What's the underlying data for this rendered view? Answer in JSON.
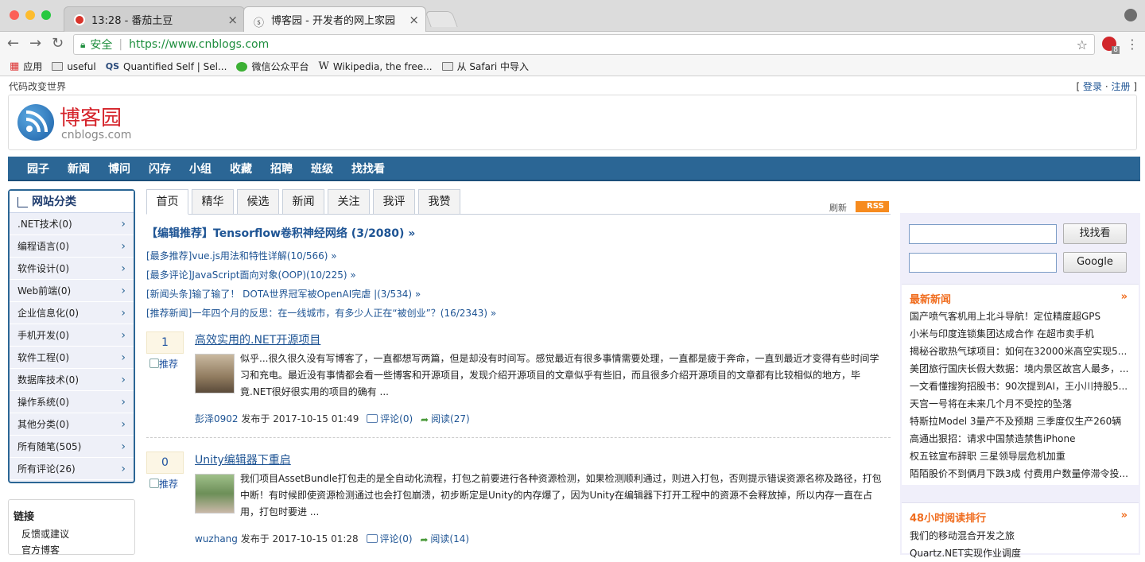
{
  "browser": {
    "tabs": [
      {
        "title": "13:28 - 番茄土豆",
        "active": false
      },
      {
        "title": "博客园 - 开发者的网上家园",
        "active": true
      }
    ],
    "security_label": "安全",
    "url": "https://www.cnblogs.com",
    "extension_badge": "8",
    "bookmarks": [
      "应用",
      "useful",
      "Quantified Self | Sel...",
      "微信公众平台",
      "Wikipedia, the free...",
      "从 Safari 中导入"
    ]
  },
  "site": {
    "slogan": "代码改变世界",
    "login": "登录",
    "register": "注册",
    "logo_cn": "博客园",
    "logo_en": "cnblogs.com",
    "nav": [
      "园子",
      "新闻",
      "博问",
      "闪存",
      "小组",
      "收藏",
      "招聘",
      "班级",
      "找找看"
    ]
  },
  "categories": {
    "title": "网站分类",
    "items": [
      ".NET技术(0)",
      "编程语言(0)",
      "软件设计(0)",
      "Web前端(0)",
      "企业信息化(0)",
      "手机开发(0)",
      "软件工程(0)",
      "数据库技术(0)",
      "操作系统(0)",
      "其他分类(0)",
      "所有随笔(505)",
      "所有评论(26)"
    ]
  },
  "links": {
    "title": "链接",
    "items": [
      "反馈或建议",
      "官方博客"
    ]
  },
  "content_tabs": [
    "首页",
    "精华",
    "候选",
    "新闻",
    "关注",
    "我评",
    "我赞"
  ],
  "refresh_label": "刷新",
  "rss_label": "RSS",
  "headline": "【编辑推荐】Tensorflow卷积神经网络 (3/2080) »",
  "sub_headlines": [
    "[最多推荐]vue.js用法和特性详解(10/566) »",
    "[最多评论]JavaScript面向对象(OOP)(10/225) »",
    "[新闻头条]输了输了！ DOTA世界冠军被OpenAI完虐 |(3/534) »",
    "[推荐新闻]一年四个月的反思：在一线城市，有多少人正在“被创业”？(16/2343) »"
  ],
  "posts": [
    {
      "digg": "1",
      "recommend": "推荐",
      "title": "高效实用的.NET开源项目",
      "summary": "似乎...很久很久没有写博客了，一直都想写两篇，但是却没有时间写。感觉最近有很多事情需要处理，一直都是疲于奔命，一直到最近才变得有些时间学习和充电。最近没有事情都会看一些博客和开源项目，发现介绍开源项目的文章似乎有些旧，而且很多介绍开源项目的文章都有比较相似的地方，毕竟.NET很好很实用的项目的确有 ...",
      "author": "彭泽0902",
      "posted": "发布于 2017-10-15 01:49",
      "comments": "评论(0)",
      "reads": "阅读(27)"
    },
    {
      "digg": "0",
      "recommend": "推荐",
      "title": "Unity编辑器下重启",
      "summary": "我们项目AssetBundle打包走的是全自动化流程，打包之前要进行各种资源检测，如果检测顺利通过，则进入打包，否则提示错误资源名称及路径，打包中断！有时候即使资源检测通过也会打包崩溃，初步断定是Unity的内存爆了，因为Unity在编辑器下打开工程中的资源不会释放掉，所以内存一直在占用，打包时要进 ...",
      "author": "wuzhang",
      "posted": "发布于 2017-10-15 01:28",
      "comments": "评论(0)",
      "reads": "阅读(14)"
    }
  ],
  "search": {
    "button1": "找找看",
    "button2": "Google"
  },
  "news": {
    "title": "最新新闻",
    "more": "»",
    "items": [
      "国产喷气客机用上北斗导航！定位精度超GPS",
      "小米与印度连锁集团达成合作 在超市卖手机",
      "揭秘谷歌热气球项目：如何在32000米高空实现5...",
      "美团旅行国庆长假大数据：境内景区故宫人最多，...",
      "一文看懂搜狗招股书：90次提到AI，王小川持股5...",
      "天宫一号将在未来几个月不受控的坠落",
      "特斯拉Model 3量产不及预期 三季度仅生产260辆",
      "高通出狠招：请求中国禁造禁售iPhone",
      "权五铉宣布辞职 三星领导层危机加重",
      "陌陌股价不到俩月下跌3成 付费用户数量停滞令投..."
    ]
  },
  "reading": {
    "title": "48小时阅读排行",
    "more": "»",
    "items": [
      "我们的移动混合开发之旅",
      "Quartz.NET实现作业调度"
    ]
  }
}
